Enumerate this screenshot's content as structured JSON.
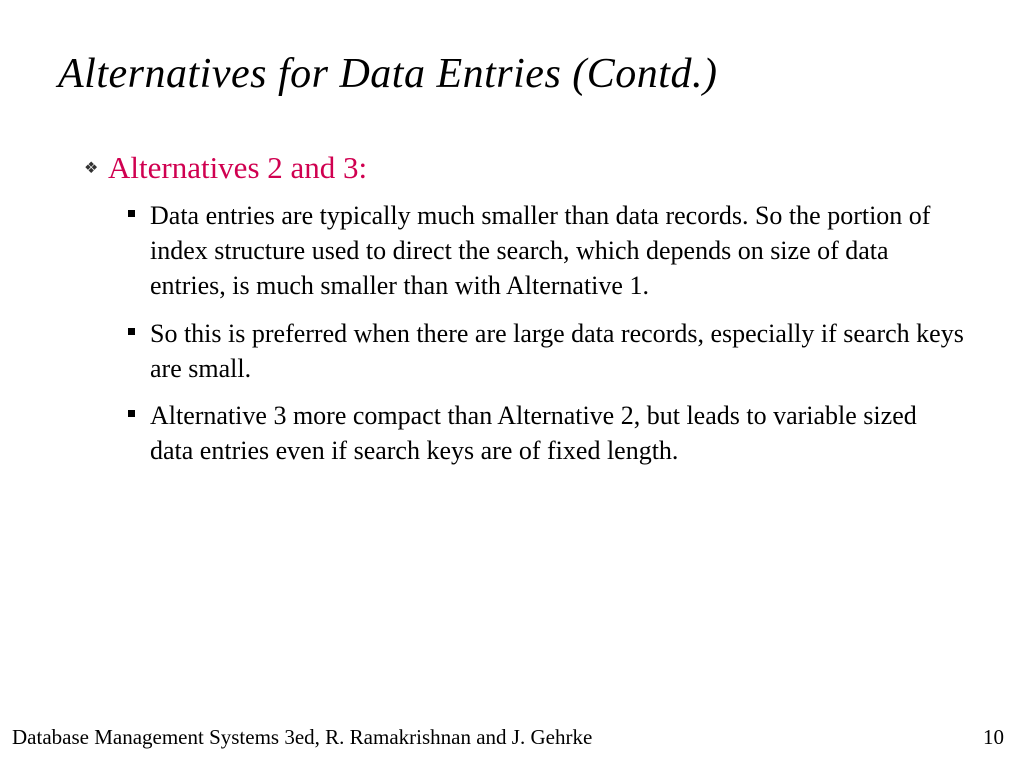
{
  "slide": {
    "title": "Alternatives for Data Entries (Contd.)",
    "main_bullet": {
      "text": "Alternatives 2 and 3:"
    },
    "sub_bullets": [
      "Data entries are typically much smaller than data records.  So the portion of index structure used to direct the search, which depends on size of data entries, is much smaller than with Alternative 1.",
      "So this is preferred when there are large data records, especially if search keys are small.",
      "Alternative 3 more compact than Alternative 2, but leads to variable sized data entries even if search keys are of fixed length."
    ]
  },
  "footer": {
    "source": "Database Management Systems 3ed, R. Ramakrishnan and J. Gehrke",
    "page_number": "10"
  }
}
